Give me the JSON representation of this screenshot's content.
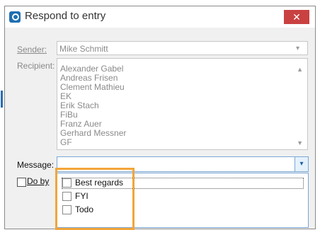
{
  "window": {
    "title": "Respond to entry",
    "close_glyph": "✕"
  },
  "sender": {
    "label": "Sender:",
    "value": "Mike Schmitt"
  },
  "recipient": {
    "label": "Recipient:",
    "items": [
      "Alexander Gabel",
      "Andreas Frisen",
      "Clement Mathieu",
      "EK",
      "Erik Stach",
      "FiBu",
      "Franz Auer",
      "Gerhard Messner",
      "GF"
    ]
  },
  "message": {
    "label": "Message:",
    "value": "",
    "options": [
      {
        "label": "Best regards",
        "checked": false
      },
      {
        "label": "FYI",
        "checked": false
      },
      {
        "label": "Todo",
        "checked": false
      }
    ]
  },
  "do_by": {
    "label": "Do by",
    "checked": false
  },
  "icons": {
    "chevron": "▾",
    "up": "▲",
    "down": "▼"
  },
  "colors": {
    "accent": "#f2a53a",
    "close": "#c94141",
    "focus_border": "#7aa7d6"
  }
}
